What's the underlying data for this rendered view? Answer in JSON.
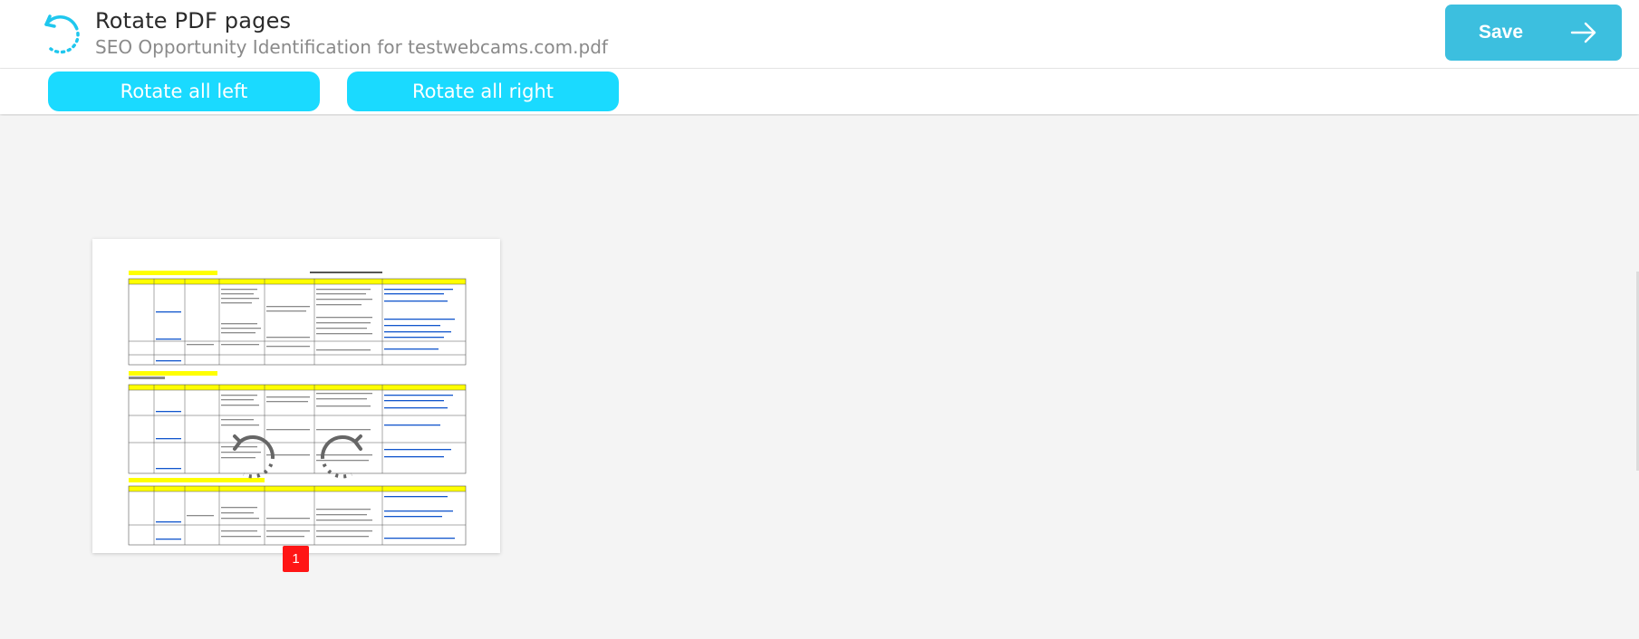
{
  "header": {
    "title": "Rotate PDF pages",
    "filename": "SEO Opportunity Identification for testwebcams.com.pdf",
    "app_icon": "rotate-dotted-icon"
  },
  "save_button": {
    "label": "Save",
    "icon": "arrow-right-icon"
  },
  "toolbar": {
    "rotate_all_left": "Rotate all left",
    "rotate_all_right": "Rotate all right"
  },
  "pages": [
    {
      "page_number": "1",
      "controls": [
        "rotate-left-icon",
        "rotate-right-icon"
      ]
    }
  ],
  "colors": {
    "accent": "#1adaff",
    "save": "#3cbfdf",
    "page_badge": "#ff1515",
    "doc_highlight": "#ffff00",
    "doc_link": "#1155cc"
  }
}
